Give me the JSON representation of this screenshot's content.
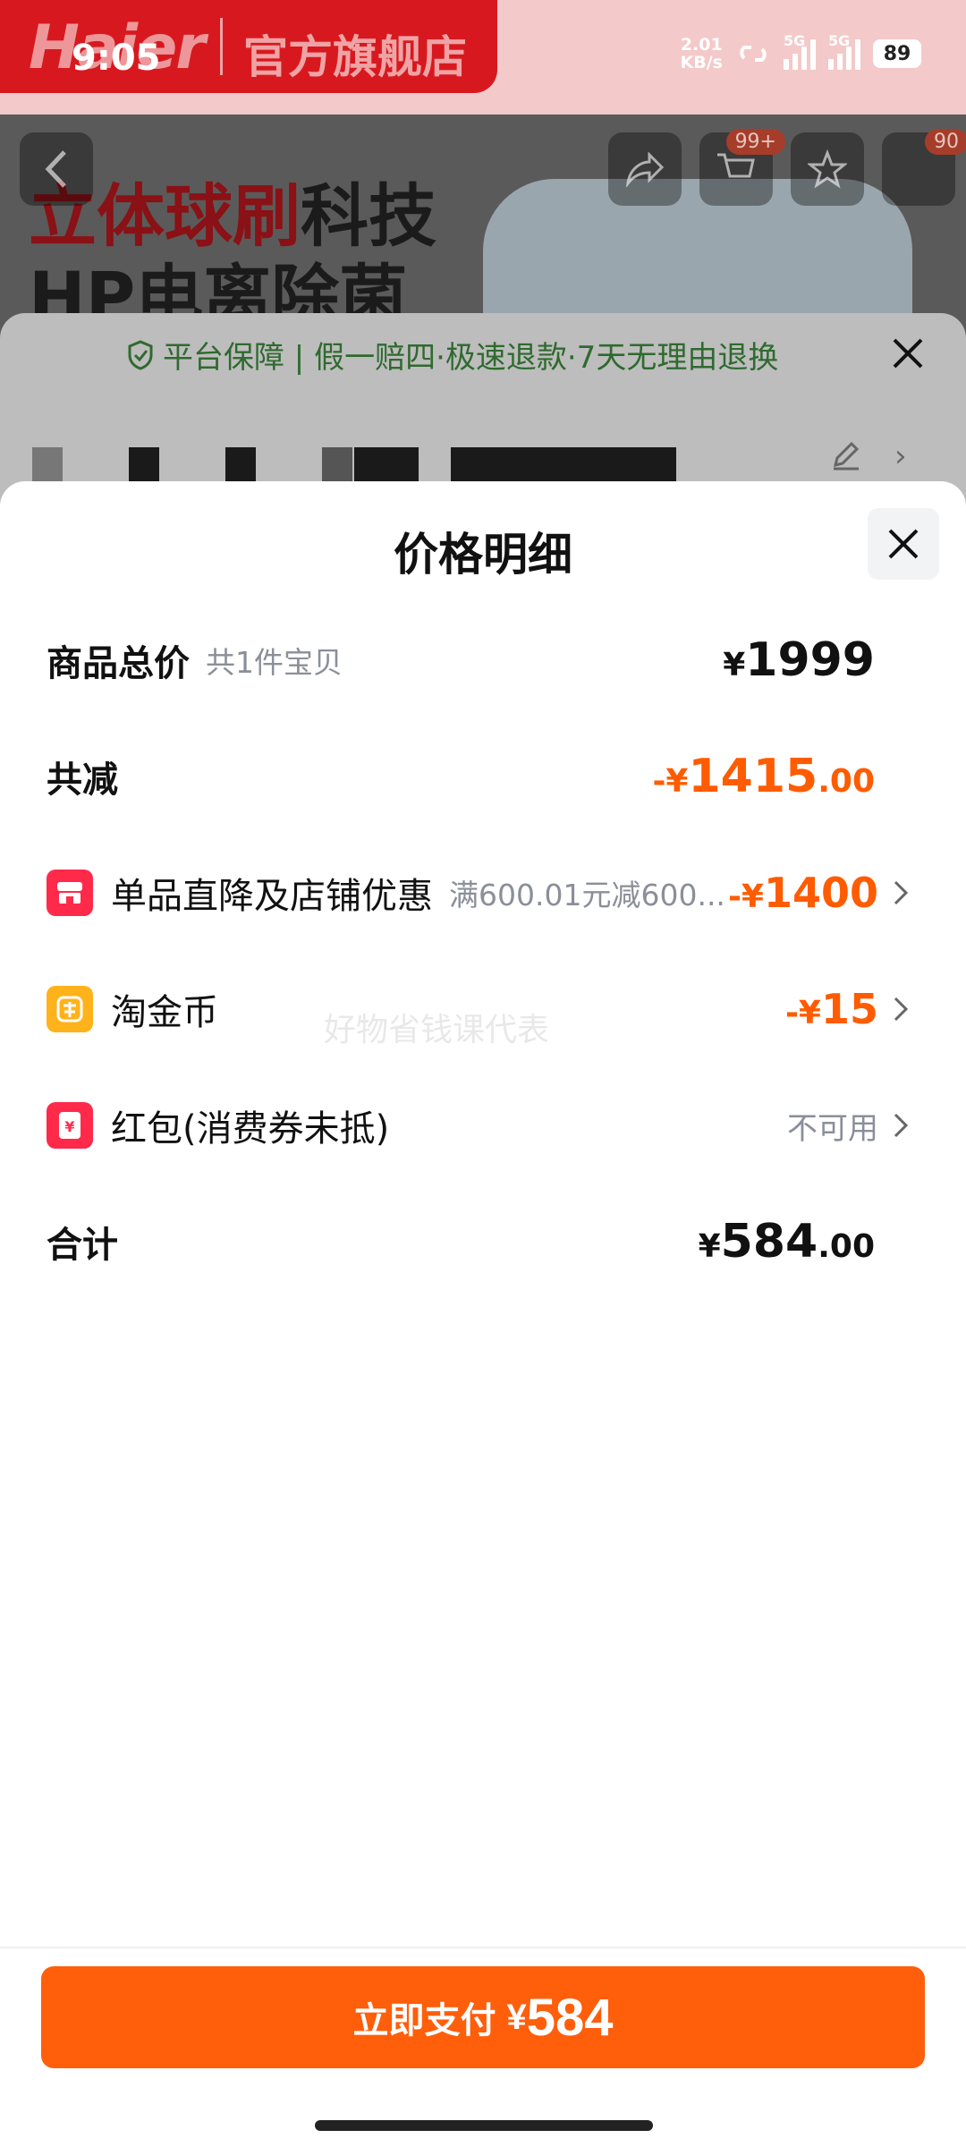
{
  "status_bar": {
    "time": "9:05",
    "net_speed_value": "2.01",
    "net_speed_unit": "KB/s",
    "sim1_tag": "5G",
    "sim2_tag": "5G",
    "battery": "89"
  },
  "background_page": {
    "brand_logo": "Haier",
    "store_name": "官方旗舰店",
    "hero_line1_red": "立体球刷",
    "hero_line1_rest": "科技",
    "hero_line2": "HP电离除菌",
    "cart_badge": "99+",
    "more_badge": "90",
    "guarantee_text": "平台保障 | 假一赔四·极速退款·7天无理由退换"
  },
  "price_detail": {
    "title": "价格明细",
    "rows": {
      "total": {
        "label": "商品总价",
        "sub": "共1件宝贝",
        "currency": "¥",
        "amount": "1999"
      },
      "reduction": {
        "label": "共减",
        "prefix": "-¥",
        "amount": "1415",
        "decimal": ".00"
      },
      "discount": {
        "label": "单品直降及店铺优惠",
        "sub": "满600.01元减600...",
        "prefix": "-¥",
        "amount": "1400"
      },
      "coins": {
        "label": "淘金币",
        "prefix": "-¥",
        "amount": "15"
      },
      "red_packet": {
        "label": "红包(消费券未抵)",
        "value": "不可用"
      },
      "sum": {
        "label": "合计",
        "currency": "¥",
        "amount": "584",
        "decimal": ".00"
      }
    },
    "watermark": "好物省钱课代表"
  },
  "footer": {
    "pay_label": "立即支付",
    "currency": "¥",
    "amount": "584"
  },
  "colors": {
    "accent_orange": "#ff5e0b",
    "brand_red": "#d7191f"
  }
}
